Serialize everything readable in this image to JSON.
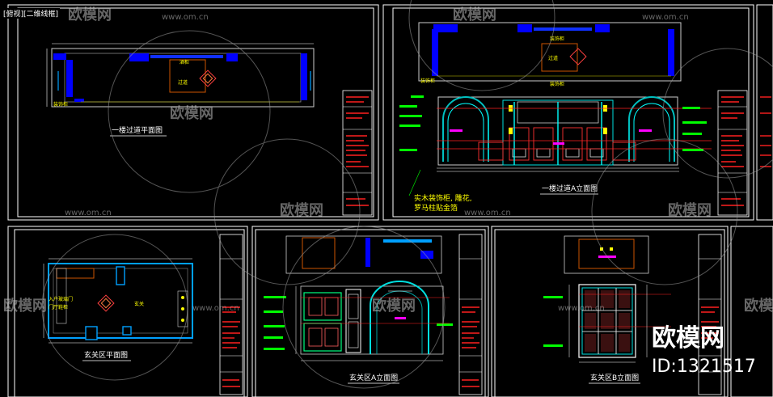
{
  "window": {
    "tab_label": "[俯视][二维线框]"
  },
  "watermark": {
    "brand": "欧模网",
    "url": "www.om.cn",
    "id_label": "ID:1321517",
    "corner_brand": "欧模网"
  },
  "drawings": {
    "top_left": {
      "title": "一楼过道平面图",
      "label_a": "过道",
      "label_b": "酒柜",
      "label_c": "装饰柜"
    },
    "top_right": {
      "title": "一楼过道A立面图",
      "label_top1": "装饰柜",
      "label_top2": "过道",
      "label_left": "装饰柜",
      "label_bottom": "装饰柜",
      "note_line1": "实木装饰柜, 雕花,",
      "note_line2": "罗马柱贴金箔"
    },
    "bottom_left": {
      "title": "玄关区平面图",
      "label_entry": "入户玻璃门",
      "label_shoe": "门厅鞋柜",
      "label_hall": "玄关"
    },
    "bottom_mid": {
      "title": "玄关区A立面图"
    },
    "bottom_right": {
      "title": "玄关区B立面图"
    }
  },
  "colors": {
    "frame": "#ffffff",
    "wall": "#0000ff",
    "neon_blue": "#00a0ff",
    "green": "#00ff00",
    "yellow": "#ffff00",
    "magenta": "#ff00ff",
    "red": "#ff2020",
    "cyan": "#00ffff",
    "orange": "#c86400"
  }
}
